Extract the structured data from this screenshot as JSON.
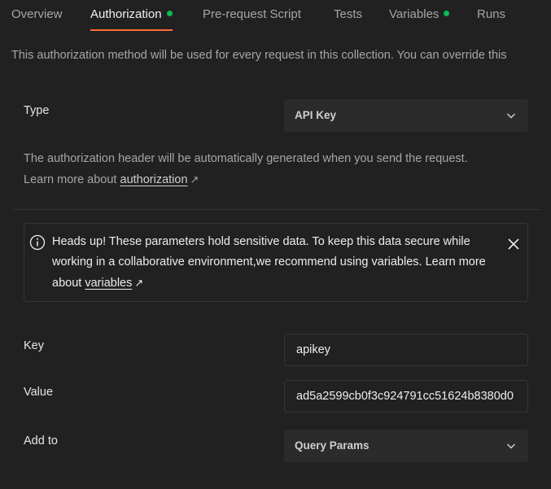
{
  "tabs": {
    "overview": "Overview",
    "authorization": "Authorization",
    "prerequest": "Pre-request Script",
    "tests": "Tests",
    "variables": "Variables",
    "runs": "Runs"
  },
  "description": "This authorization method will be used for every request in this collection. You can override this",
  "type": {
    "label": "Type",
    "value": "API Key"
  },
  "help": {
    "text": "The authorization header will be automatically generated when you send the request. Learn more about ",
    "link": "authorization",
    "arrow": "↗"
  },
  "alert": {
    "text": "Heads up! These parameters hold sensitive data. To keep this data secure while working in a collaborative environment,we recommend using variables. Learn more about ",
    "link": "variables",
    "arrow": "↗"
  },
  "key": {
    "label": "Key",
    "value": "apikey"
  },
  "value": {
    "label": "Value",
    "value": "ad5a2599cb0f3c924791cc51624b8380d0"
  },
  "add_to": {
    "label": "Add to",
    "value": "Query Params"
  },
  "colors": {
    "accent": "#ff6c37",
    "status_dot": "#0cbb52",
    "background": "#212121"
  }
}
